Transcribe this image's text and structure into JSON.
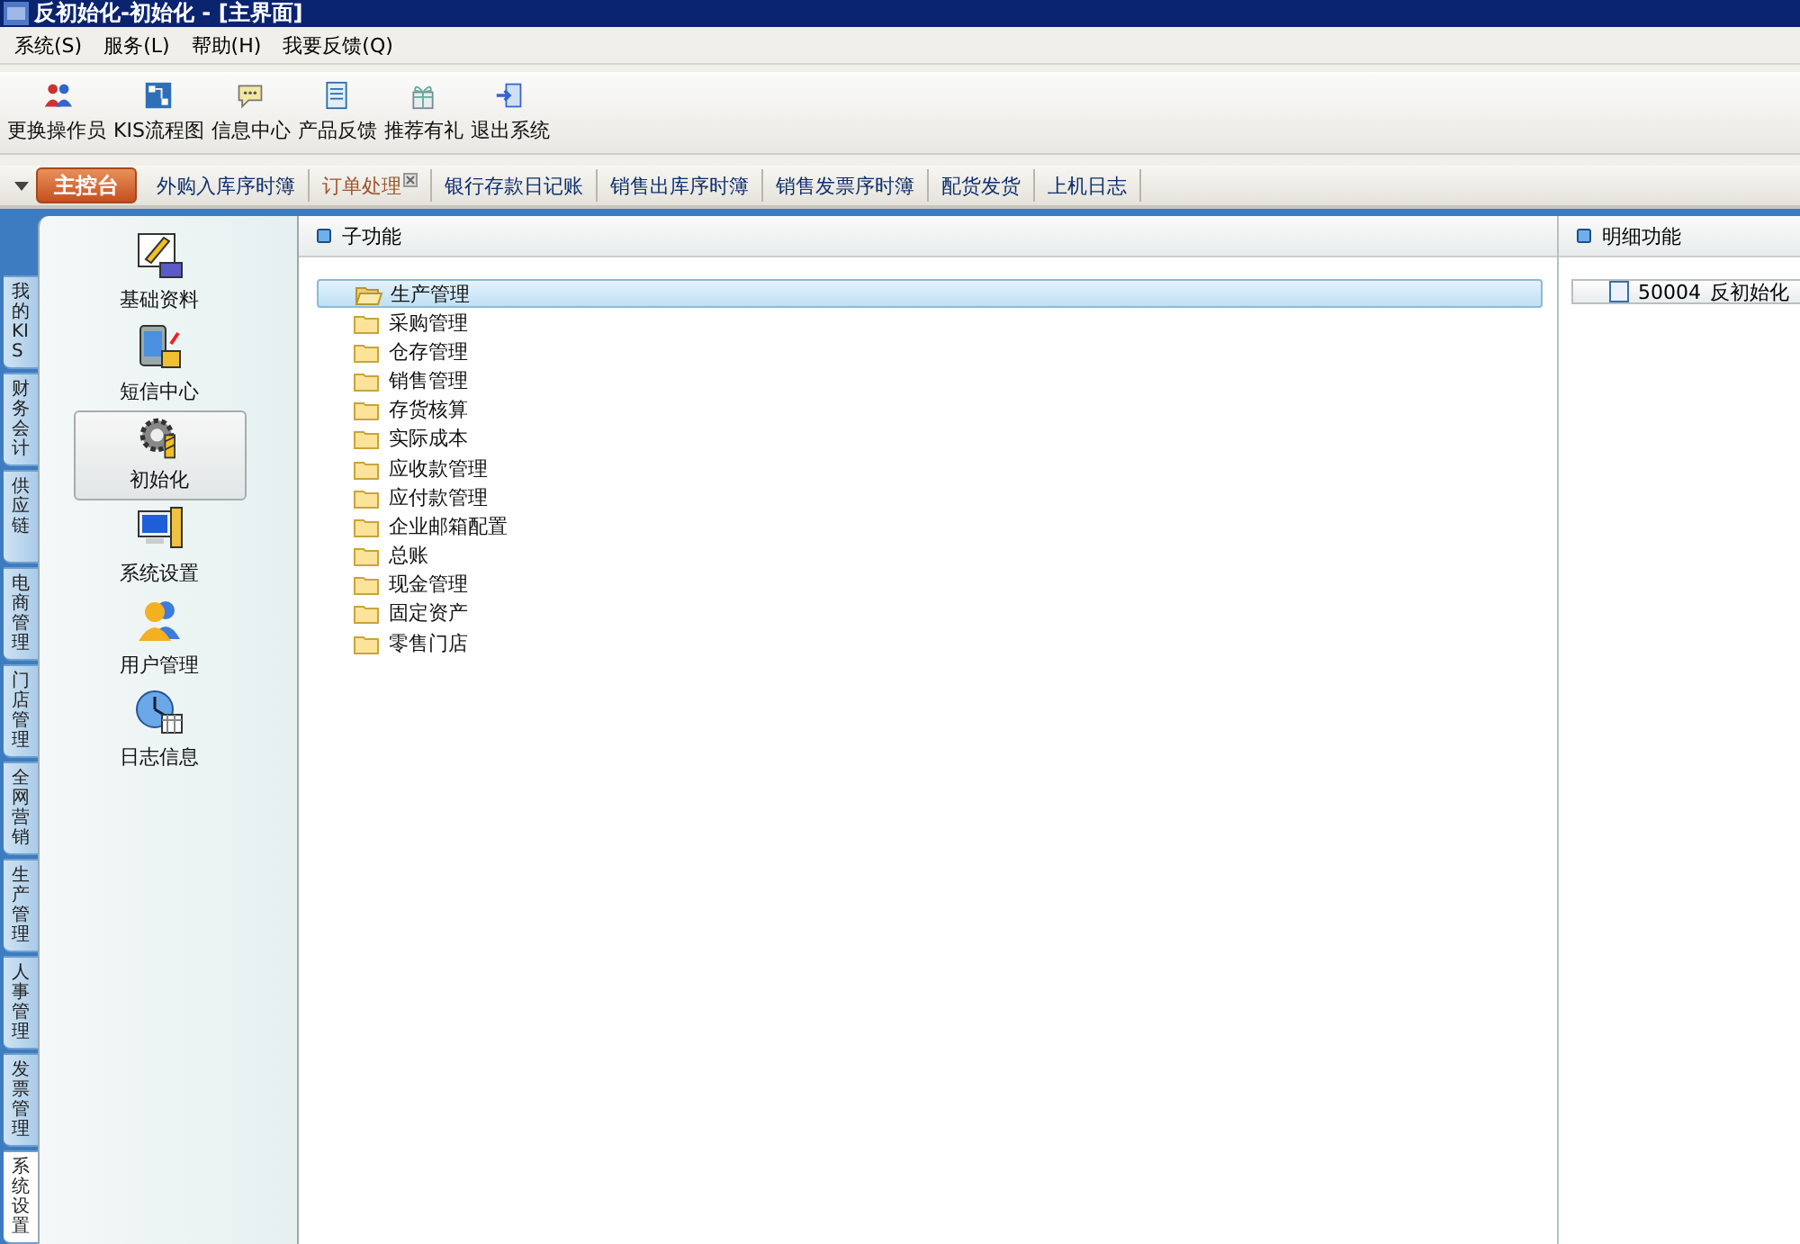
{
  "window": {
    "title": "反初始化-初始化 - [主界面]"
  },
  "menu": [
    {
      "label": "系统(S)"
    },
    {
      "label": "服务(L)"
    },
    {
      "label": "帮助(H)"
    },
    {
      "label": "我要反馈(Q)"
    }
  ],
  "toolbar": [
    {
      "label": "更换操作员",
      "kind": "people"
    },
    {
      "label": "KIS流程图",
      "kind": "flow"
    },
    {
      "label": "信息中心",
      "kind": "chat"
    },
    {
      "label": "产品反馈",
      "kind": "doc"
    },
    {
      "label": "推荐有礼",
      "kind": "gift"
    },
    {
      "label": "退出系统",
      "kind": "exit"
    }
  ],
  "tabs": [
    {
      "label": "主控台",
      "selected": true,
      "closable": false
    },
    {
      "label": "外购入库序时簿",
      "selected": false,
      "closable": false
    },
    {
      "label": "订单处理",
      "selected": false,
      "closable": true
    },
    {
      "label": "银行存款日记账",
      "selected": false,
      "closable": false
    },
    {
      "label": "销售出库序时簿",
      "selected": false,
      "closable": false
    },
    {
      "label": "销售发票序时簿",
      "selected": false,
      "closable": false
    },
    {
      "label": "配货发货",
      "selected": false,
      "closable": false
    },
    {
      "label": "上机日志",
      "selected": false,
      "closable": false
    }
  ],
  "module_tabs": [
    {
      "label": "我的KIS",
      "selected": false
    },
    {
      "label": "财务会计",
      "selected": false
    },
    {
      "label": "供应链",
      "selected": false
    },
    {
      "label": "电商管理",
      "selected": false
    },
    {
      "label": "门店管理",
      "selected": false
    },
    {
      "label": "全网营销",
      "selected": false
    },
    {
      "label": "生产管理",
      "selected": false
    },
    {
      "label": "人事管理",
      "selected": false
    },
    {
      "label": "发票管理",
      "selected": false
    },
    {
      "label": "系统设置",
      "selected": true
    }
  ],
  "nav_items": [
    {
      "label": "基础资料",
      "kind": "edit",
      "selected": false
    },
    {
      "label": "短信中心",
      "kind": "phone",
      "selected": false
    },
    {
      "label": "初始化",
      "kind": "gear",
      "selected": true
    },
    {
      "label": "系统设置",
      "kind": "monitor",
      "selected": false
    },
    {
      "label": "用户管理",
      "kind": "users",
      "selected": false
    },
    {
      "label": "日志信息",
      "kind": "clock",
      "selected": false
    }
  ],
  "sub_functions": {
    "title": "子功能",
    "items": [
      {
        "label": "生产管理",
        "selected": true
      },
      {
        "label": "采购管理",
        "selected": false
      },
      {
        "label": "仓存管理",
        "selected": false
      },
      {
        "label": "销售管理",
        "selected": false
      },
      {
        "label": "存货核算",
        "selected": false
      },
      {
        "label": "实际成本",
        "selected": false
      },
      {
        "label": "应收款管理",
        "selected": false
      },
      {
        "label": "应付款管理",
        "selected": false
      },
      {
        "label": "企业邮箱配置",
        "selected": false
      },
      {
        "label": "总账",
        "selected": false
      },
      {
        "label": "现金管理",
        "selected": false
      },
      {
        "label": "固定资产",
        "selected": false
      },
      {
        "label": "零售门店",
        "selected": false
      }
    ]
  },
  "details": {
    "title": "明细功能",
    "items": [
      {
        "code": "50004",
        "label": "反初始化"
      }
    ]
  }
}
